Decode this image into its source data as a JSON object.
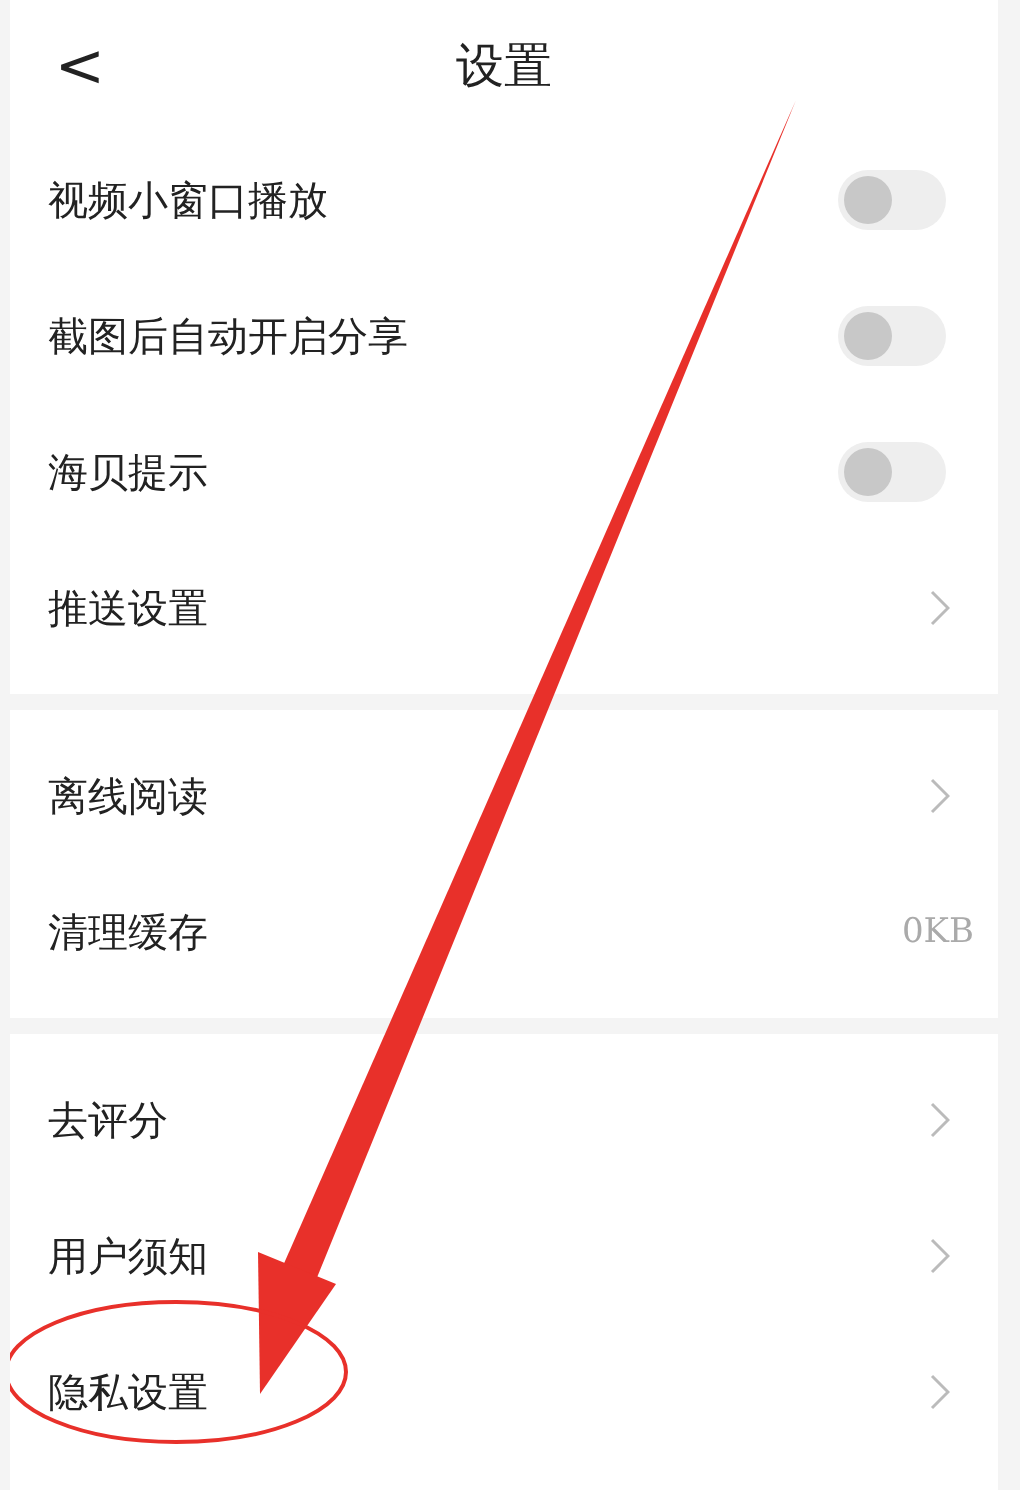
{
  "header": {
    "back": "<",
    "title": "设置"
  },
  "sections": [
    {
      "items": [
        {
          "kind": "toggle",
          "label": "视频小窗口播放",
          "on": false
        },
        {
          "kind": "toggle",
          "label": "截图后自动开启分享",
          "on": false
        },
        {
          "kind": "toggle",
          "label": "海贝提示",
          "on": false
        },
        {
          "kind": "link",
          "label": "推送设置"
        }
      ]
    },
    {
      "items": [
        {
          "kind": "link",
          "label": "离线阅读"
        },
        {
          "kind": "value",
          "label": "清理缓存",
          "value": "0KB"
        }
      ]
    },
    {
      "items": [
        {
          "kind": "link",
          "label": "去评分"
        },
        {
          "kind": "link",
          "label": "用户须知"
        },
        {
          "kind": "link",
          "label": "隐私设置"
        }
      ]
    }
  ]
}
